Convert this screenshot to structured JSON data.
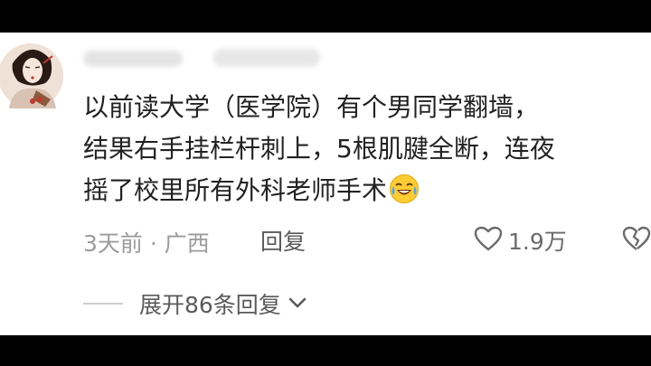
{
  "comment": {
    "username": "",
    "lines": [
      "以前读大学（医学院）有个男同学翻墙，",
      "结果右手挂栏杆刺上，5根肌腱全断，连夜",
      "摇了校里所有外科老师手术"
    ],
    "emoji": "laughing-crying-face"
  },
  "meta": {
    "time": "3天前",
    "separator": "·",
    "location": "广西",
    "reply_label": "回复"
  },
  "actions": {
    "like_count": "1.9万"
  },
  "replies": {
    "expand_label": "展开86条回复"
  },
  "colors": {
    "text": "#222222",
    "meta": "#9b9b9b",
    "icon": "#6b6b6b"
  }
}
